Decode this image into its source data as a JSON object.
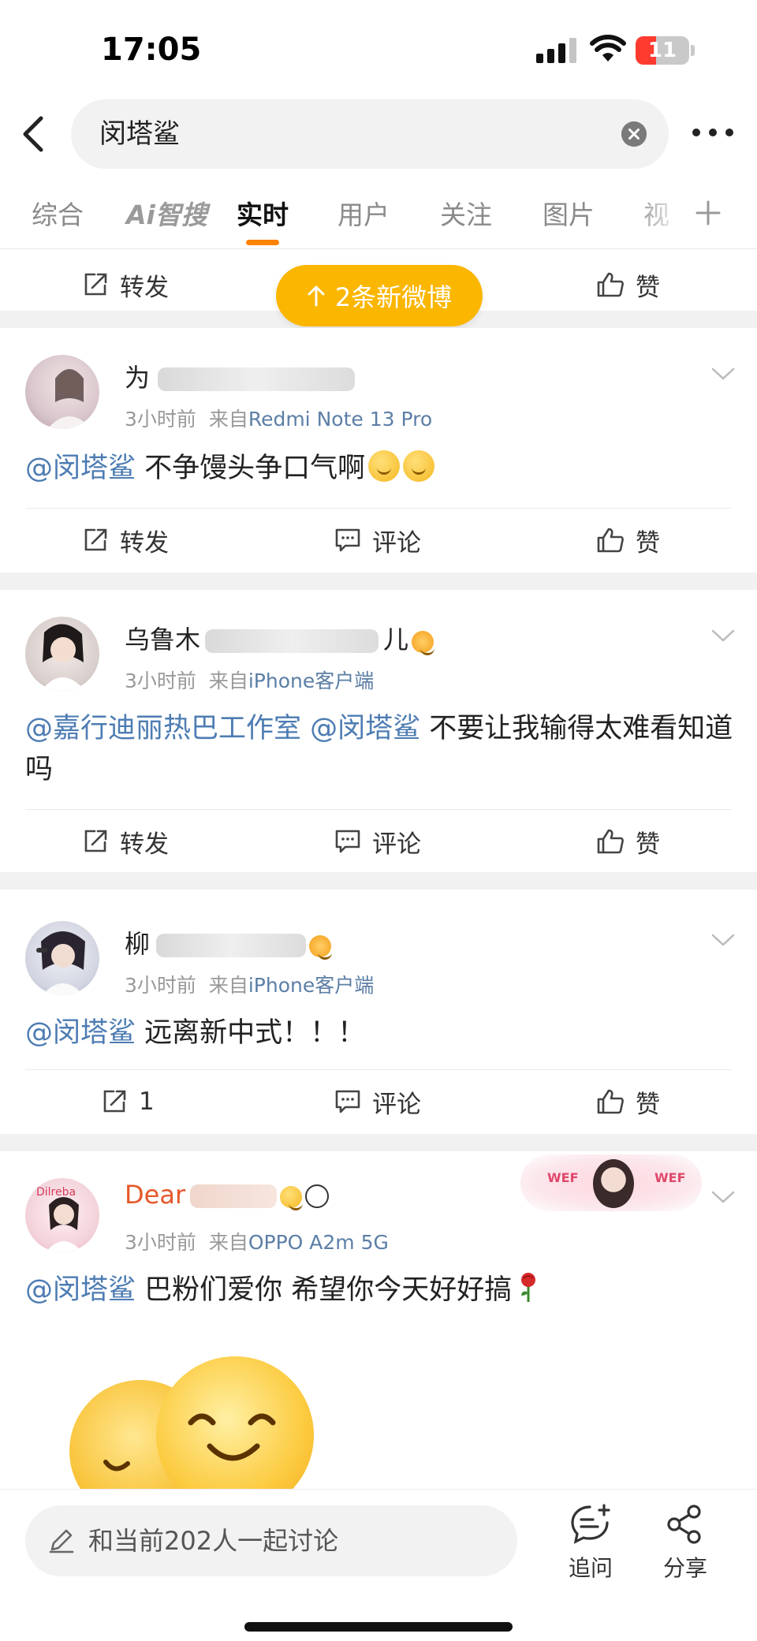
{
  "status_bar": {
    "time": "17:05",
    "battery": "11"
  },
  "search": {
    "query": "闵塔鲨"
  },
  "tabs": [
    {
      "label": "综合"
    },
    {
      "label": "Ai智搜"
    },
    {
      "label": "实时",
      "active": true
    },
    {
      "label": "用户"
    },
    {
      "label": "关注"
    },
    {
      "label": "图片"
    },
    {
      "label": "视"
    }
  ],
  "new_posts_pill": "2条新微博",
  "top_actions": {
    "repost": "转发",
    "like": "赞"
  },
  "posts": [
    {
      "username": "为",
      "time": "3小时前",
      "via": "来自",
      "source": "Redmi Note 13 Pro",
      "mention": "@闵塔鲨",
      "text": " 不争馒头争口气啊",
      "actions": {
        "repost": "转发",
        "comment": "评论",
        "like": "赞"
      }
    },
    {
      "username": "乌鲁木",
      "username_tail": "儿",
      "time": "3小时前",
      "via": "来自",
      "source": "iPhone客户端",
      "mention": "@嘉行迪丽热巴工作室",
      "mention2": "@闵塔鲨",
      "text": " 不要让我输得太难看知道吗",
      "actions": {
        "repost": "转发",
        "comment": "评论",
        "like": "赞"
      }
    },
    {
      "username": "柳",
      "time": "3小时前",
      "via": "来自",
      "source": "iPhone客户端",
      "mention": "@闵塔鲨",
      "text": " 远离新中式！！！",
      "actions": {
        "repost": "1",
        "comment": "评论",
        "like": "赞"
      }
    },
    {
      "username": "Dear",
      "time": "3小时前",
      "via": "来自",
      "source": "OPPO A2m 5G",
      "mention": "@闵塔鲨",
      "text": "  巴粉们爱你 希望你今天好好搞",
      "badge": "WEF"
    }
  ],
  "bottom_bar": {
    "discuss_placeholder": "和当前202人一起讨论",
    "ask": "追问",
    "share": "分享"
  },
  "colors": {
    "accent": "#ff8200",
    "pill": "#fbb600",
    "mention": "#4d7cb3",
    "source": "#5b7ea6"
  }
}
